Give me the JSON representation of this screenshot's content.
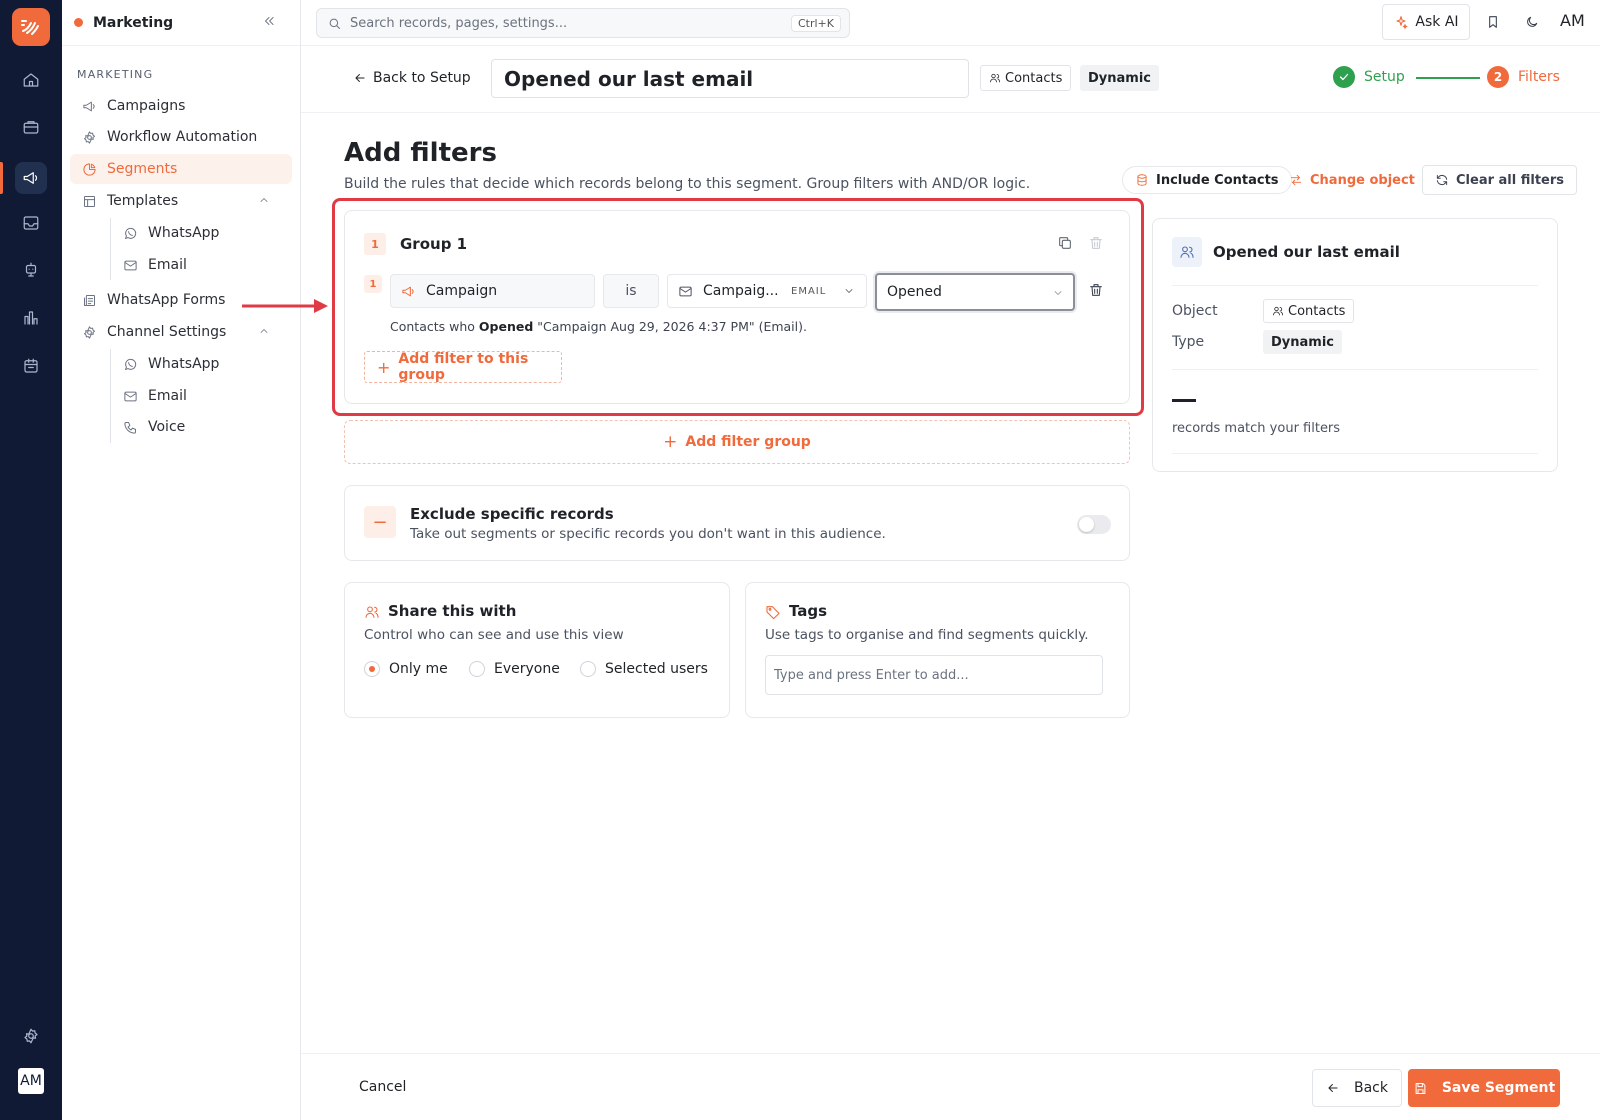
{
  "colors": {
    "accent": "#f06a3c",
    "rail": "#101a35",
    "highlight": "#e03a45",
    "success": "#2fa14e"
  },
  "rail": {
    "items": [
      "home-icon",
      "briefcase-icon",
      "megaphone-icon",
      "inbox-icon",
      "robot-icon",
      "chart-icon",
      "calendar-icon"
    ],
    "active": "megaphone-icon",
    "settings_icon": "gear-icon",
    "avatar": "AM"
  },
  "sidebar": {
    "title": "Marketing",
    "section": "MARKETING",
    "items": [
      {
        "label": "Campaigns",
        "icon": "megaphone-icon"
      },
      {
        "label": "Workflow Automation",
        "icon": "gear-icon"
      },
      {
        "label": "Segments",
        "icon": "pie-icon",
        "active": true
      },
      {
        "label": "Templates",
        "icon": "template-icon",
        "expanded": true
      },
      {
        "label": "WhatsApp",
        "icon": "whatsapp-icon",
        "sub": true
      },
      {
        "label": "Email",
        "icon": "mail-icon",
        "sub": true
      },
      {
        "label": "WhatsApp Forms",
        "icon": "form-icon"
      },
      {
        "label": "Channel Settings",
        "icon": "gear-icon",
        "expanded": true
      },
      {
        "label": "WhatsApp",
        "icon": "whatsapp-icon",
        "sub": true
      },
      {
        "label": "Email",
        "icon": "mail-icon",
        "sub": true
      },
      {
        "label": "Voice",
        "icon": "phone-icon",
        "sub": true
      }
    ]
  },
  "topbar": {
    "search_placeholder": "Search records, pages, settings...",
    "shortcut": "Ctrl+K",
    "ask_ai": "Ask AI",
    "avatar": "AM"
  },
  "header": {
    "back_label": "Back to Setup",
    "segment_name": "Opened our last email",
    "object_chip": "Contacts",
    "type_chip": "Dynamic",
    "steps": [
      {
        "label": "Setup",
        "state": "done"
      },
      {
        "label": "Filters",
        "number": "2",
        "state": "current"
      }
    ]
  },
  "main": {
    "title": "Add filters",
    "subtitle": "Build the rules that decide which records belong to this segment. Group filters with AND/OR logic.",
    "actions": {
      "include": "Include Contacts",
      "change_object": "Change object",
      "clear_all": "Clear all filters"
    },
    "group": {
      "number": "1",
      "title": "Group 1",
      "filter": {
        "number": "1",
        "field": "Campaign",
        "operator": "is",
        "campaign": "Campaig...",
        "campaign_tag": "EMAIL",
        "value": "Opened"
      },
      "desc_prefix": "Contacts who ",
      "desc_bold": "Opened",
      "desc_suffix": " \"Campaign Aug 29, 2026 4:37 PM\" (Email).",
      "add_filter": "Add filter to this group"
    },
    "add_group": "Add filter group",
    "exclude": {
      "title": "Exclude specific records",
      "subtitle": "Take out segments or specific records you don't want in this audience.",
      "enabled": false
    },
    "share": {
      "title": "Share this with",
      "subtitle": "Control who can see and use this view",
      "options": [
        "Only me",
        "Everyone",
        "Selected users"
      ],
      "selected": "Only me"
    },
    "tags": {
      "title": "Tags",
      "subtitle": "Use tags to organise and find segments quickly.",
      "placeholder": "Type and press Enter to add..."
    }
  },
  "summary": {
    "title": "Opened our last email",
    "object_label": "Object",
    "object_value": "Contacts",
    "type_label": "Type",
    "type_value": "Dynamic",
    "count_label": "records match your filters"
  },
  "footer": {
    "cancel": "Cancel",
    "back": "Back",
    "save": "Save Segment"
  }
}
